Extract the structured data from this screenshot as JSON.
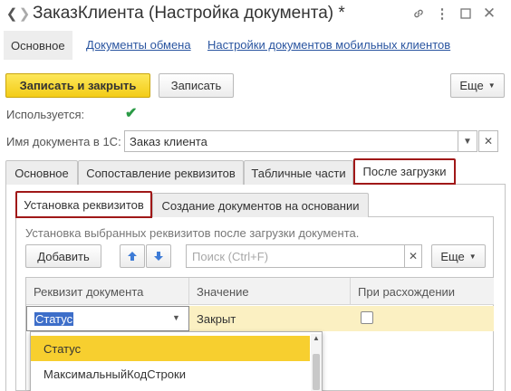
{
  "window": {
    "title": "ЗаказКлиента (Настройка документа) *",
    "back_icon": "arrow-left-icon",
    "forward_icon": "arrow-right-icon",
    "link_icon": "link-icon",
    "menu_icon": "kebab-icon",
    "maximize_icon": "maximize-icon",
    "close_icon": "close-icon"
  },
  "top_tabs": {
    "main": "Основное",
    "exchange_docs": "Документы обмена",
    "mobile_settings": "Настройки документов мобильных клиентов"
  },
  "toolbar": {
    "save_close": "Записать и закрыть",
    "save": "Записать",
    "more": "Еще"
  },
  "form": {
    "used_label": "Используется:",
    "used_checked": true,
    "doc_name_label": "Имя документа в 1С:",
    "doc_name_value": "Заказ клиента"
  },
  "tabs": [
    "Основное",
    "Сопоставление реквизитов",
    "Табличные части",
    "После загрузки"
  ],
  "active_tab": "После загрузки",
  "subtabs": [
    "Установка реквизитов",
    "Создание документов на основании"
  ],
  "active_subtab": "Установка реквизитов",
  "hint": "Установка выбранных реквизитов после загрузки документа.",
  "table_toolbar": {
    "add": "Добавить",
    "up_icon": "arrow-up-icon",
    "down_icon": "arrow-down-icon",
    "search_placeholder": "Поиск (Ctrl+F)",
    "more": "Еще"
  },
  "table": {
    "columns": [
      "Реквизит документа",
      "Значение",
      "При расхождении"
    ],
    "rows": [
      {
        "attribute": "Статус",
        "value": "Закрыт",
        "on_mismatch": false
      }
    ]
  },
  "dropdown": {
    "items": [
      "Статус",
      "МаксимальныйКодСтроки"
    ],
    "selected": "Статус"
  },
  "colors": {
    "accent_yellow": "#f3cc17",
    "active_tab_border": "#a01818",
    "link": "#2a55a0",
    "selection_row": "#fbf0c2",
    "dropdown_selected": "#f7cf2f",
    "text_selection": "#3d6ec9"
  }
}
